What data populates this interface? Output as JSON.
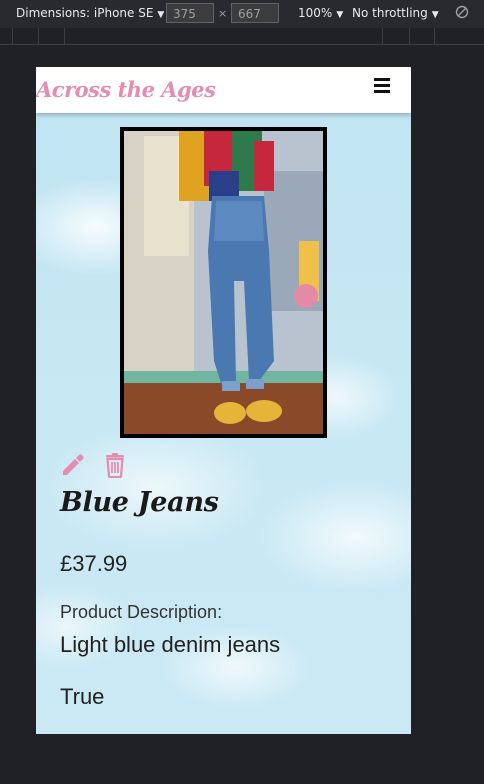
{
  "devtools": {
    "dimensions_label": "Dimensions: iPhone SE",
    "width_value": "375",
    "times": "×",
    "height_value": "667",
    "zoom_label": "100%",
    "throttle_label": "No throttling",
    "caret": "▼"
  },
  "site": {
    "brand": "Across the Ages",
    "menu_icon": "hamburger-icon"
  },
  "product": {
    "image_alt": "Person wearing high-waisted light blue denim jeans and a colour-block shirt with yellow sneakers",
    "title": "Blue Jeans",
    "price": "£37.99",
    "description_label": "Product Description:",
    "description": "Light blue denim jeans",
    "flag": "True"
  },
  "actions": {
    "edit_icon": "pencil-icon",
    "delete_icon": "trash-icon",
    "accent_color": "#e58cb1"
  }
}
